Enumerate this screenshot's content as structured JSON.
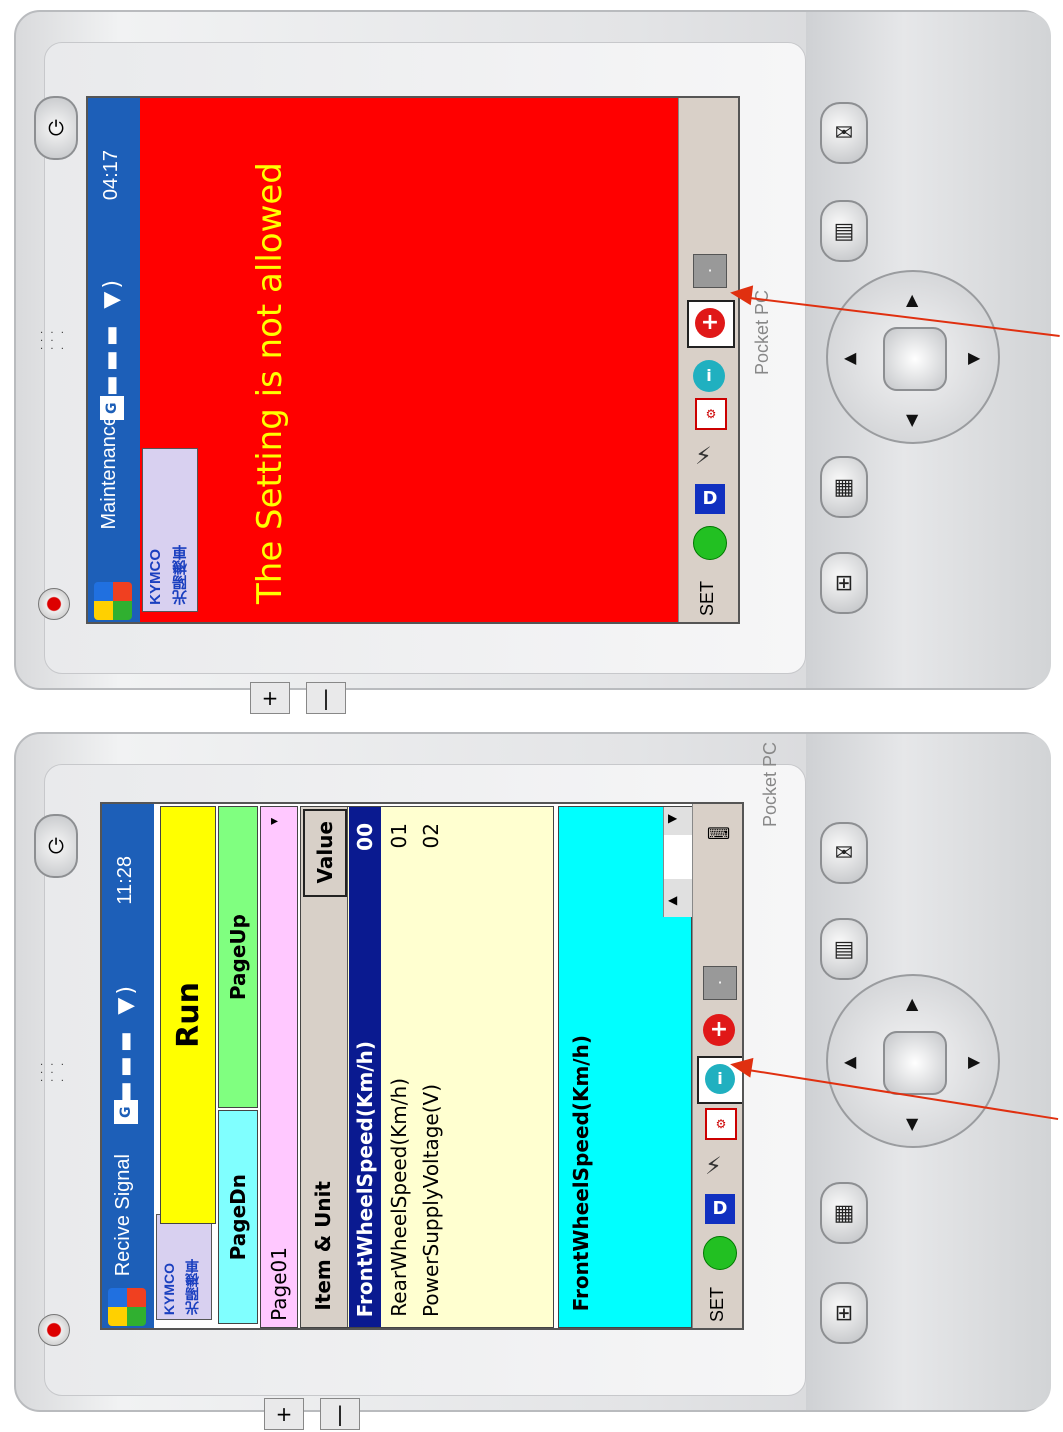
{
  "top_device": {
    "title_bar": {
      "app_title": "Maintenance",
      "clock": "04:17",
      "signal": "G"
    },
    "logo": {
      "line1": "KYMCO",
      "line2": "光陽機車"
    },
    "message": "The Setting is not allowed",
    "taskbar": {
      "set_label": "SET"
    },
    "screen_color": "#ff0000",
    "message_color": "#ffff00",
    "branding": "Pocket PC"
  },
  "bottom_device": {
    "title_bar": {
      "app_title": "Recive Signal",
      "clock": "11:28",
      "signal": "G"
    },
    "logo": {
      "line1": "KYMCO",
      "line2": "光陽機車"
    },
    "buttons": {
      "run": "Run",
      "page_dn": "PageDn",
      "page_up": "PageUp"
    },
    "page_select": "Page01",
    "table": {
      "headers": [
        "Item & Unit",
        "Value"
      ],
      "rows": [
        {
          "item": "FrontWheelSpeed(Km/h)",
          "value": "00"
        },
        {
          "item": "RearWheelSpeed(Km/h)",
          "value": "01"
        },
        {
          "item": "PowerSupplyVoltage(V)",
          "value": "02"
        }
      ]
    },
    "detail_label": "FrontWheelSpeed(Km/h)",
    "taskbar": {
      "set_label": "SET"
    },
    "branding": "Pocket PC"
  }
}
